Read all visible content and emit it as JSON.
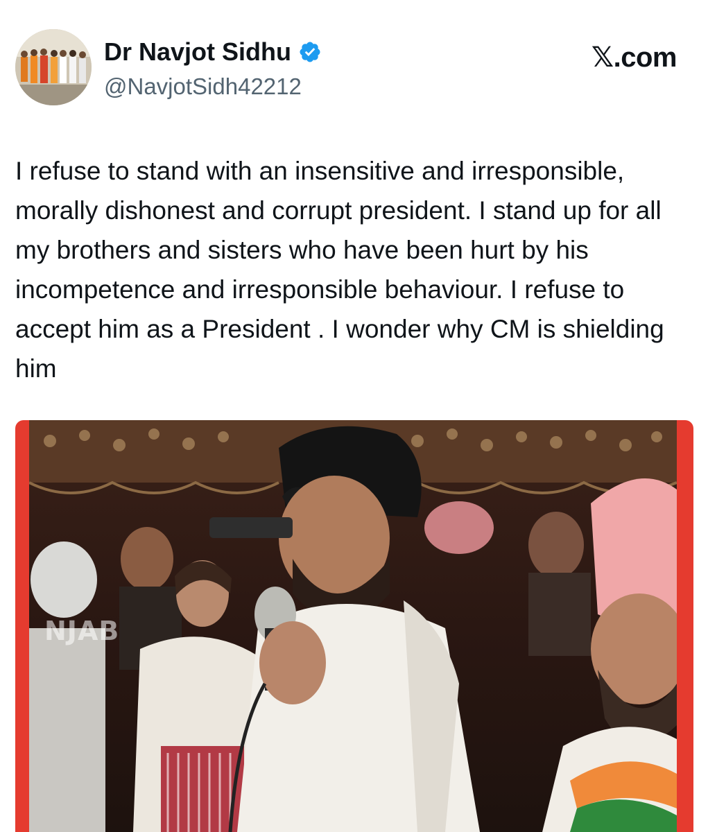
{
  "source": {
    "label": "𝕏.com"
  },
  "author": {
    "display_name": "Dr Navjot Sidhu",
    "handle": "@NavjotSidh42212",
    "verified": true,
    "avatar_icon": "profile-photo-group",
    "verified_color": "#1d9bf0"
  },
  "tweet": {
    "text": "I refuse to stand with an insensitive and irresponsible, morally dishonest and corrupt president. I stand up for all my brothers and sisters who have been hurt by his incompetence and irresponsible behaviour. I refuse to accept him as a President . I wonder why CM is shielding him"
  },
  "media": {
    "watermark": "NJAB",
    "frame_color": "#e53b2f"
  }
}
